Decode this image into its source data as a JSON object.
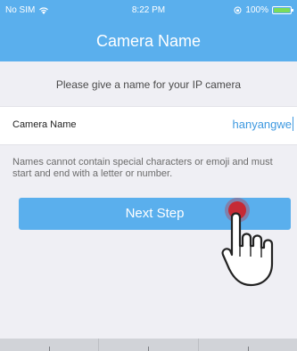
{
  "status_bar": {
    "carrier": "No SIM",
    "time": "8:22 PM",
    "battery": "100%",
    "battery_level": 1.0,
    "icons": [
      "wifi-icon",
      "rotation-lock-icon",
      "battery-icon"
    ]
  },
  "nav": {
    "title": "Camera Name"
  },
  "form": {
    "prompt": "Please give a name for your IP camera",
    "field_label": "Camera Name",
    "field_value": "hanyangwe",
    "hint": "Names cannot contain special characters or emoji and must start and end with a letter or number."
  },
  "actions": {
    "next_label": "Next Step"
  },
  "colors": {
    "primary": "#5aafed",
    "background": "#efeff4",
    "input_text": "#3e99e0",
    "tap_indicator": "#c62a35"
  }
}
